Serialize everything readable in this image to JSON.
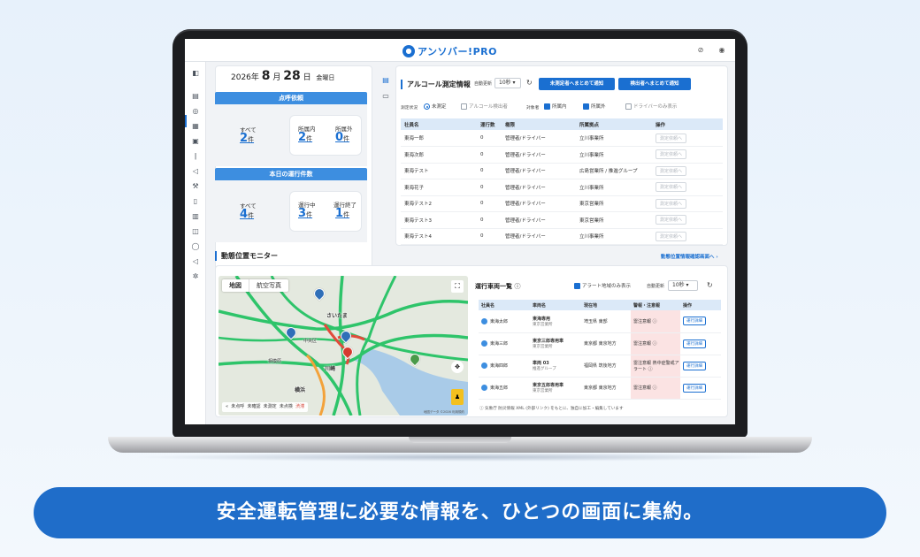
{
  "header": {
    "logo_text": "アンソバー!PRO"
  },
  "date": {
    "year": "2026年",
    "month": "8",
    "month_unit": "月",
    "day": "28",
    "day_unit": "日",
    "weekday": "金曜日"
  },
  "roll_call": {
    "title": "点呼依頼",
    "all_label": "すべて",
    "all_count": "2",
    "unit": "件",
    "inside_label": "所属内",
    "inside_count": "2",
    "outside_label": "所属外",
    "outside_count": "0"
  },
  "trips": {
    "title": "本日の運行件数",
    "all_label": "すべて",
    "all_count": "4",
    "unit": "件",
    "running_label": "運行中",
    "running_count": "3",
    "done_label": "運行終了",
    "done_count": "1"
  },
  "alcohol": {
    "title": "アルコール測定情報",
    "auto_label": "自動更新",
    "auto_value": "10秒",
    "btn_unmeasured": "未測定者へまとめて通知",
    "btn_detected": "検出者へまとめて通知",
    "filter_status": "測定状況",
    "opt_unmeasured": "未測定",
    "opt_detected": "アルコール検出者",
    "filter_target": "対象者",
    "opt_inside": "所属内",
    "opt_outside": "所属外",
    "opt_driver_only": "ドライバーのみ表示",
    "columns": [
      "社員名",
      "運行数",
      "権限",
      "所属拠点",
      "操作"
    ],
    "rows": [
      {
        "name": "東海一郎",
        "trips": "0",
        "role": "管理者/ドライバー",
        "base": "立川事業所",
        "action": "測定依頼へ"
      },
      {
        "name": "東海次郎",
        "trips": "0",
        "role": "管理者/ドライバー",
        "base": "立川事業所",
        "action": "測定依頼へ"
      },
      {
        "name": "東海テスト",
        "trips": "0",
        "role": "管理者/ドライバー",
        "base": "広島営業所 / 推進グループ",
        "action": "測定依頼へ"
      },
      {
        "name": "東海花子",
        "trips": "0",
        "role": "管理者/ドライバー",
        "base": "立川事業所",
        "action": "測定依頼へ"
      },
      {
        "name": "東海テスト2",
        "trips": "0",
        "role": "管理者/ドライバー",
        "base": "東京営業所",
        "action": "測定依頼へ"
      },
      {
        "name": "東海テスト3",
        "trips": "0",
        "role": "管理者/ドライバー",
        "base": "東京営業所",
        "action": "測定依頼へ"
      },
      {
        "name": "東海テスト4",
        "trips": "0",
        "role": "管理者/ドライバー",
        "base": "立川事業所",
        "action": "測定依頼へ"
      }
    ]
  },
  "monitor": {
    "title": "動態位置モニター",
    "link": "動態位置情報確認画面へ ›",
    "map_tab_map": "地図",
    "map_tab_aerial": "航空写真",
    "map_labels": [
      "さいたま",
      "川崎",
      "横浜",
      "相模原",
      "中央区"
    ],
    "legend": [
      "未点呼",
      "未確認",
      "未測定",
      "未点検",
      "渋滞"
    ],
    "map_credit": "地図データ ©2026 利用規約"
  },
  "vehicles": {
    "title": "運行車両一覧",
    "alert_only": "アラート地域のみ表示",
    "auto_label": "自動更新",
    "auto_value": "10秒",
    "columns": [
      "社員名",
      "車両名",
      "現在地",
      "警報・注意報",
      "操作"
    ],
    "rows": [
      {
        "name": "東海太郎",
        "vehicle": "東海専用",
        "vehicle_sub": "東京営業所",
        "location": "埼玉県 東部",
        "alert": "雷注意報",
        "action": "運行詳細"
      },
      {
        "name": "東海三郎",
        "vehicle": "東京三郎専用車",
        "vehicle_sub": "東京営業所",
        "location": "東京都 東京地方",
        "alert": "雷注意報",
        "action": "運行詳細"
      },
      {
        "name": "東海四郎",
        "vehicle": "車両 03",
        "vehicle_sub": "推進グループ",
        "location": "福岡県 筑後地方",
        "alert": "雷注意報 熱中症警戒アラート",
        "action": "運行詳細"
      },
      {
        "name": "東海五郎",
        "vehicle": "東京五郎専用車",
        "vehicle_sub": "東京営業所",
        "location": "東京都 東京地方",
        "alert": "雷注意報",
        "action": "運行詳細"
      }
    ],
    "footnote": "ⓘ 気象庁 防災情報 XML (外部リンク) をもとに、独自に加工・編集しています"
  },
  "caption": "安全運転管理に必要な情報を、ひとつの画面に集約。",
  "colors": {
    "accent": "#1a6fd1",
    "caption_bg": "#1f6dc9",
    "warn_bg": "#fbe3e3"
  }
}
